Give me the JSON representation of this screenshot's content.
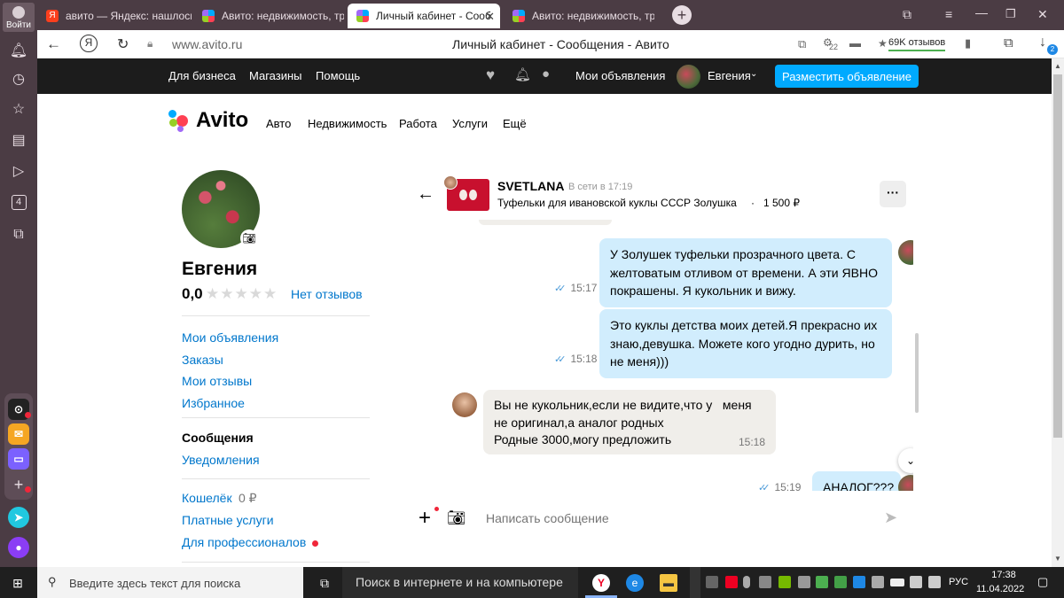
{
  "browser": {
    "login_label": "Войти",
    "tabs": [
      {
        "title": "авито — Яндекс: нашлось"
      },
      {
        "title": "Авито: недвижимость, тра"
      },
      {
        "title": "Личный кабинет - Сооб"
      },
      {
        "title": "Авито: недвижимость, тра"
      }
    ],
    "url": "www.avito.ru",
    "page_title": "Личный кабинет - Сообщения - Авито",
    "reviews_badge": "69K отзывов",
    "tray_counter": "22",
    "downloads_badge": "2"
  },
  "avito_nav": {
    "business": "Для бизнеса",
    "shops": "Магазины",
    "help": "Помощь",
    "my_ads": "Мои объявления",
    "user": "Евгения",
    "publish": "Разместить объявление"
  },
  "avito_menu": {
    "logo": "Avito",
    "items": [
      "Авто",
      "Недвижимость",
      "Работа",
      "Услуги",
      "Ещё"
    ]
  },
  "profile": {
    "name": "Евгения",
    "rating": "0,0",
    "stars": "★★★★★",
    "reviews_link": "Нет отзывов",
    "links_group1": [
      "Мои объявления",
      "Заказы",
      "Мои отзывы",
      "Избранное"
    ],
    "messages_label": "Сообщения",
    "notifications_label": "Уведомления",
    "wallet_label": "Кошелёк",
    "wallet_value": "0 ₽",
    "paid_services": "Платные услуги",
    "for_pros": "Для профессионалов"
  },
  "chat": {
    "partner_name": "SVETLANA",
    "status": "В сети в 17:19",
    "item": "Туфельки для ивановской куклы СССР Золушка",
    "price": "1 500 ₽",
    "menu_glyph": "···",
    "messages": [
      {
        "dir": "out",
        "text": "У Золушек туфельки прозрачного цвета. С желтоватым отливом от времени. А эти ЯВНО покрашены. Я кукольник и вижу.",
        "time": "15:17"
      },
      {
        "dir": "out",
        "text": "Это куклы детства моих детей.Я прекрасно их знаю,девушка. Можете кого угодно дурить, но не меня)))",
        "time": "15:18"
      },
      {
        "dir": "in",
        "lines": [
          "Вы не кукольник,если не видите,что у   меня",
          "не оригинал,а аналог родных",
          "Родные 3000,могу предложить"
        ],
        "time": "15:18"
      },
      {
        "dir": "out",
        "text": "АНАЛОГ???",
        "time": "15:19"
      }
    ],
    "input_placeholder": "Написать сообщение",
    "ticks": "✓✓"
  },
  "taskbar": {
    "search_placeholder": "Введите здесь текст для поиска",
    "internet_search": "Поиск в интернете и на компьютере",
    "lang": "РУС",
    "time": "17:38",
    "date": "11.04.2022"
  },
  "colors": {
    "browser_chrome": "#4b3c44",
    "avito_nav": "#1c1c1c",
    "link": "#0077cc",
    "accent": "#00aaff",
    "bubble_out": "#d1edfd",
    "bubble_in": "#f0eeea"
  }
}
